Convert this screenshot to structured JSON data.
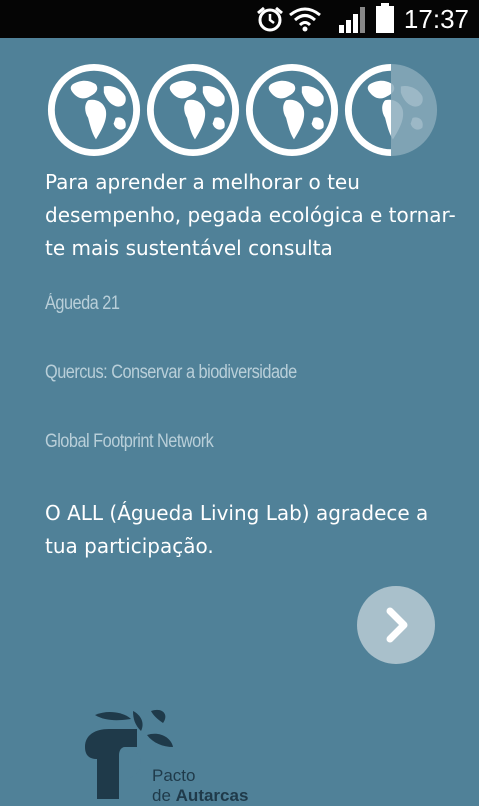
{
  "status_bar": {
    "time": "17:37",
    "icons": [
      "alarm-icon",
      "wifi-icon",
      "signal-icon",
      "battery-icon"
    ]
  },
  "rating": {
    "icon": "globe-icon",
    "value": 3.5,
    "max": 4
  },
  "intro_text": "Para aprender a melhorar o teu desempenho, pegada ecológica e tornar-te mais sustentável consulta",
  "links": [
    "Águeda 21",
    "Quercus: Conservar a biodiversidade",
    "Global Footprint Network"
  ],
  "thanks_text": "O ALL (Águeda Living Lab) agradece a tua participação.",
  "next_button": {
    "icon": "chevron-right-icon"
  },
  "logo": {
    "line1": "Pacto",
    "line2_prefix": "de",
    "line2_bold": "Autarcas"
  },
  "colors": {
    "background": "#508198",
    "status_bar": "#050505",
    "text": "#ffffff",
    "link": "#b9cfd9",
    "button": "#a9c0cb"
  }
}
